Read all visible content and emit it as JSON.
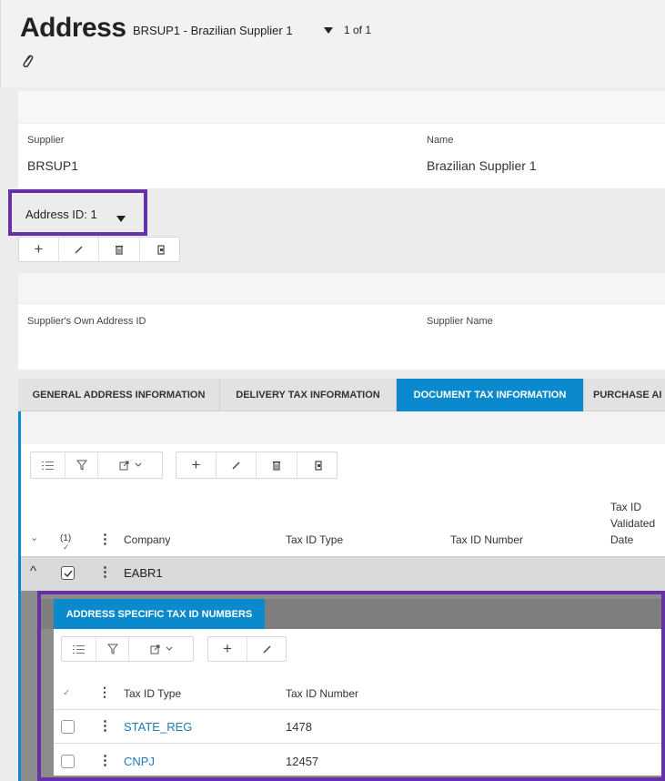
{
  "header": {
    "title": "Address",
    "record": "BRSUP1 - Brazilian Supplier 1",
    "pager": "1 of 1"
  },
  "supplier_card": {
    "supplier_label": "Supplier",
    "supplier_value": "BRSUP1",
    "name_label": "Name",
    "name_value": "Brazilian Supplier 1"
  },
  "address": {
    "selector_label": "Address ID: 1"
  },
  "address_card": {
    "own_id_label": "Supplier's Own Address ID",
    "supplier_name_label": "Supplier Name"
  },
  "tabs": [
    {
      "label": "GENERAL ADDRESS INFORMATION",
      "active": false
    },
    {
      "label": "DELIVERY TAX INFORMATION",
      "active": false
    },
    {
      "label": "DOCUMENT TAX INFORMATION",
      "active": true
    },
    {
      "label": "PURCHASE AI",
      "active": false
    }
  ],
  "grid": {
    "selected_count": "(1)",
    "columns": [
      "Company",
      "Tax ID Type",
      "Tax ID Number",
      "Tax ID Validated Date"
    ],
    "rows": [
      {
        "company": "EABR1",
        "selected": true
      }
    ]
  },
  "nested": {
    "tab_label": "ADDRESS SPECIFIC TAX ID NUMBERS",
    "columns": [
      "Tax ID Type",
      "Tax ID Number"
    ],
    "rows": [
      {
        "tax_id_type": "STATE_REG",
        "tax_id_number": "1478"
      },
      {
        "tax_id_type": "CNPJ",
        "tax_id_number": "12457"
      }
    ]
  },
  "colors": {
    "accent": "#0a89cc",
    "highlight_box": "#6631a8"
  }
}
